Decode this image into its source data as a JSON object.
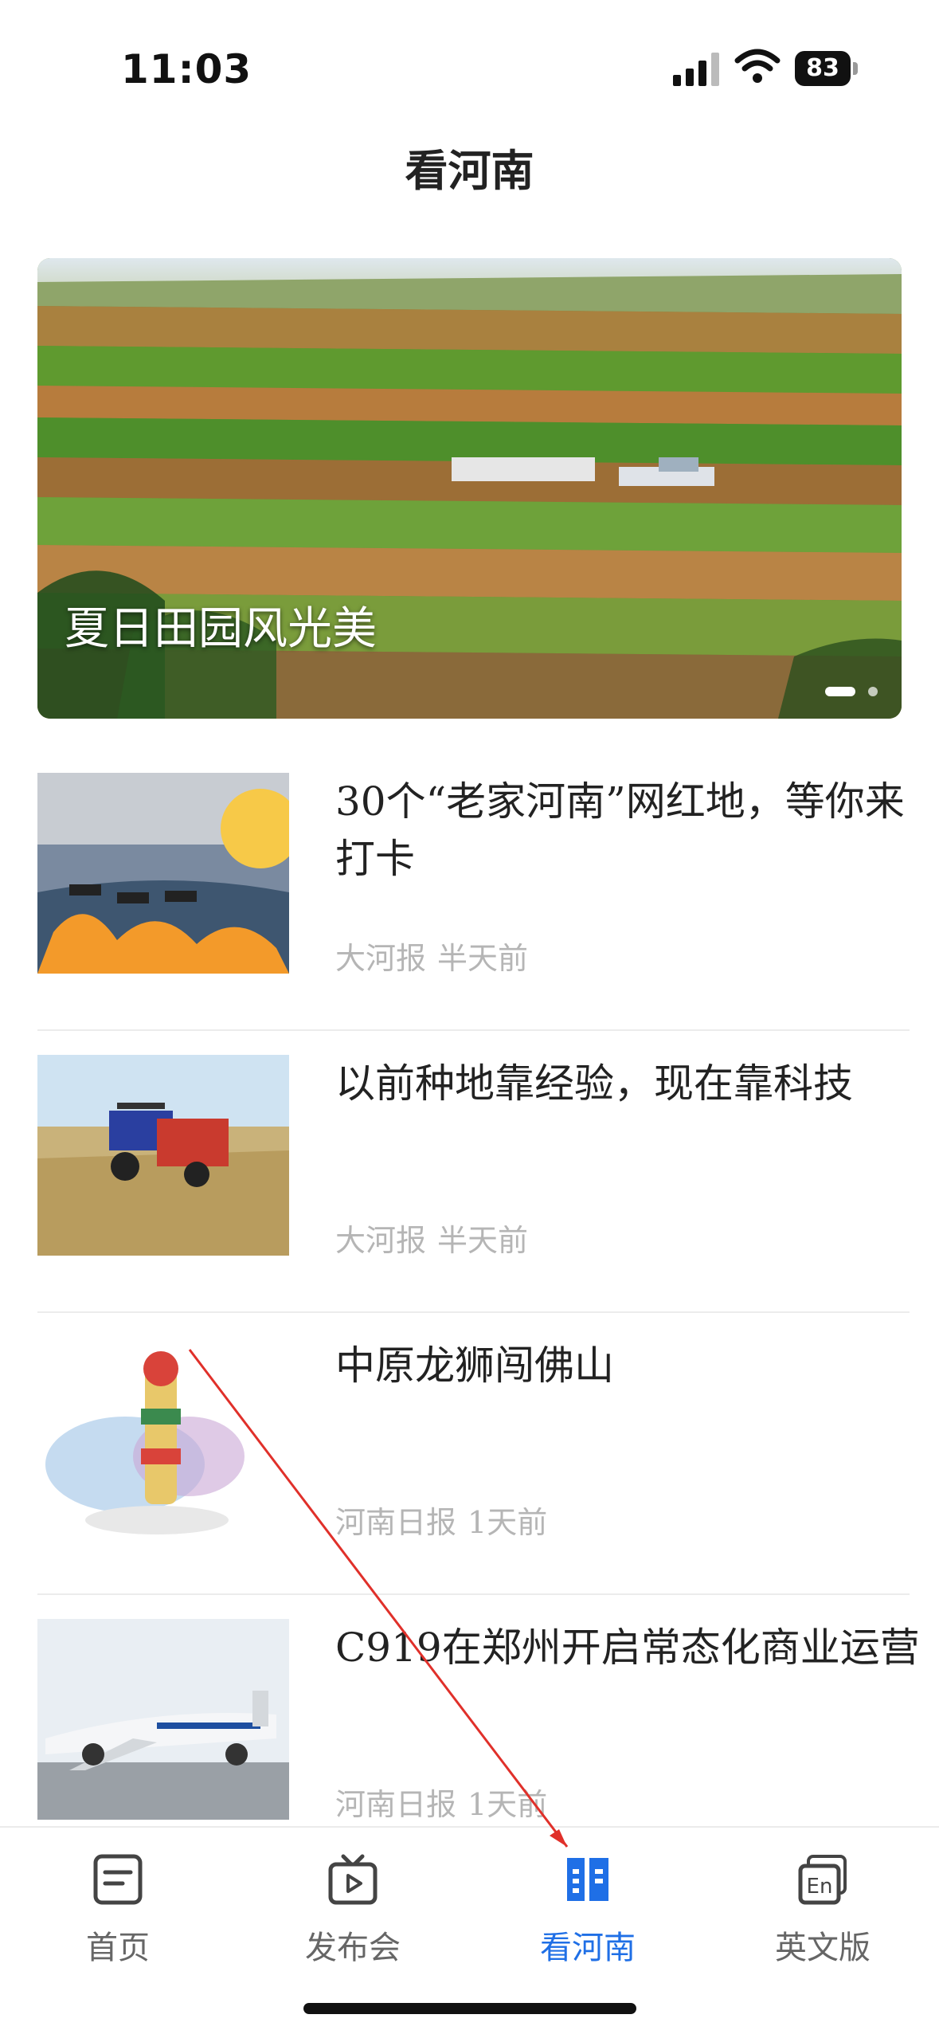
{
  "status_bar": {
    "time": "11:03",
    "battery": "83"
  },
  "header": {
    "title": "看河南"
  },
  "banner": {
    "caption": "夏日田园风光美",
    "page_count": 2,
    "active_page": 1
  },
  "news": [
    {
      "title": "30个“老家河南”网红地，等你来打卡",
      "source": "大河报",
      "time": "半天前"
    },
    {
      "title": "以前种地靠经验，现在靠科技",
      "source": "大河报",
      "time": "半天前"
    },
    {
      "title": "中原龙狮闯佛山",
      "source": "河南日报",
      "time": "1天前"
    },
    {
      "title": "C919在郑州开启常态化商业运营",
      "source": "河南日报",
      "time": "1天前"
    }
  ],
  "tabbar": {
    "tabs": [
      {
        "label": "首页",
        "icon": "document-icon"
      },
      {
        "label": "发布会",
        "icon": "tv-icon"
      },
      {
        "label": "看河南",
        "icon": "book-icon"
      },
      {
        "label": "英文版",
        "icon": "en-icon"
      }
    ],
    "active_index": 2
  },
  "colors": {
    "accent": "#1f6fe6",
    "meta_text": "#b5b5b5",
    "annotation_arrow": "#e0302a"
  }
}
